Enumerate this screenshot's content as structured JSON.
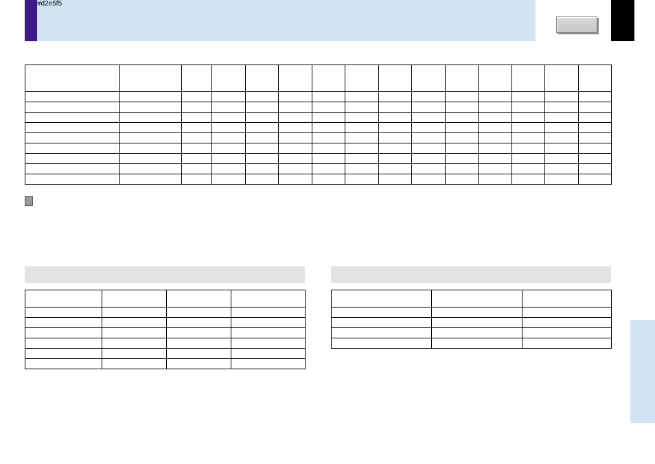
{
  "header": {
    "band_color": "#d2e5f5",
    "accent_color": "#3c1a8c",
    "button_label": "",
    "page_corner_color": "#000000"
  },
  "chart_data": {
    "type": "table",
    "title": "",
    "columns": [
      "",
      "",
      "",
      "",
      "",
      "",
      "",
      "",
      "",
      "",
      "",
      "",
      "",
      "",
      ""
    ],
    "rows": [
      [
        "",
        "",
        "",
        "",
        "",
        "",
        "",
        "",
        "",
        "",
        "",
        "",
        "",
        "",
        ""
      ],
      [
        "",
        "",
        "",
        "",
        "",
        "",
        "",
        "",
        "",
        "",
        "",
        "",
        "",
        "",
        ""
      ],
      [
        "",
        "",
        "",
        "",
        "",
        "",
        "",
        "",
        "",
        "",
        "",
        "",
        "",
        "",
        ""
      ],
      [
        "",
        "",
        "",
        "",
        "",
        "",
        "",
        "",
        "",
        "",
        "",
        "",
        "",
        "",
        ""
      ],
      [
        "",
        "",
        "",
        "",
        "",
        "",
        "",
        "",
        "",
        "",
        "",
        "",
        "",
        "",
        ""
      ],
      [
        "",
        "",
        "",
        "",
        "",
        "",
        "",
        "",
        "",
        "",
        "",
        "",
        "",
        "",
        ""
      ],
      [
        "",
        "",
        "",
        "",
        "",
        "",
        "",
        "",
        "",
        "",
        "",
        "",
        "",
        "",
        ""
      ],
      [
        "",
        "",
        "",
        "",
        "",
        "",
        "",
        "",
        "",
        "",
        "",
        "",
        "",
        "",
        ""
      ],
      [
        "",
        "",
        "",
        "",
        "",
        "",
        "",
        "",
        "",
        "",
        "",
        "",
        "",
        "",
        ""
      ]
    ]
  },
  "footnote": "",
  "left_table": {
    "heading": "",
    "columns": [
      "",
      "",
      "",
      ""
    ],
    "rows": [
      [
        "",
        "",
        "",
        ""
      ],
      [
        "",
        "",
        "",
        ""
      ],
      [
        "",
        "",
        "",
        ""
      ],
      [
        "",
        "",
        "",
        ""
      ],
      [
        "",
        "",
        "",
        ""
      ],
      [
        "",
        "",
        "",
        ""
      ]
    ]
  },
  "right_table": {
    "heading": "",
    "columns": [
      "",
      "",
      ""
    ],
    "rows": [
      [
        "",
        "",
        ""
      ],
      [
        "",
        "",
        ""
      ],
      [
        "",
        "",
        ""
      ],
      [
        "",
        "",
        ""
      ]
    ]
  },
  "side_tab": {
    "label": ""
  }
}
